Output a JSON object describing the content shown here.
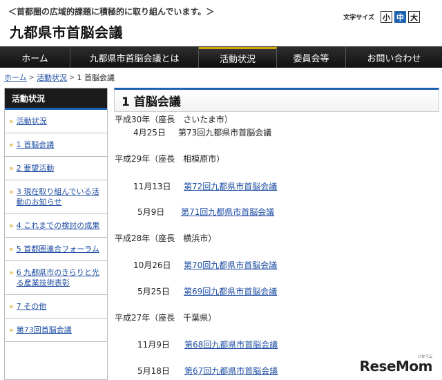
{
  "header": {
    "tagline": "＜首都圏の広域的課題に積極的に取り組んでいます。＞",
    "site_title": "九都県市首脳会議",
    "font_size_label": "文字サイズ",
    "font_size_options": [
      "小",
      "中",
      "大"
    ]
  },
  "nav": {
    "items": [
      "ホーム",
      "九都県市首脳会議とは",
      "活動状況",
      "委員会等",
      "お問い合わせ"
    ]
  },
  "breadcrumb": {
    "home": "ホーム",
    "section": "活動状況",
    "current": "1 首脳会議"
  },
  "sidebar": {
    "heading": "活動状況",
    "items": [
      "活動状況",
      "1 首脳会議",
      "2 要望活動",
      "3 現在取り組んでいる活動のお知らせ",
      "4 これまでの検討の成果",
      "5 首都圏連合フォーラム",
      "6 九都県市のきらりと光る産業技術表彰",
      "7 その他",
      "第73回首脳会議"
    ]
  },
  "main": {
    "heading": "1 首脳会議",
    "years": [
      "平成30年（座長　さいたま市）",
      "平成29年（座長　相模原市）",
      "平成28年（座長　横浜市）",
      "平成27年（座長　千葉県）"
    ],
    "meetings": [
      {
        "date": "4月25日",
        "title": "第73回九都県市首脳会議"
      },
      {
        "date": "11月13日",
        "title": "第72回九都県市首脳会議"
      },
      {
        "date": "5月9日",
        "title": "第71回九都県市首脳会議"
      },
      {
        "date": "10月26日",
        "title": "第70回九都県市首脳会議"
      },
      {
        "date": "5月25日",
        "title": "第69回九都県市首脳会議"
      },
      {
        "date": "11月9日",
        "title": "第68回九都県市首脳会議"
      },
      {
        "date": "5月18日",
        "title": "第67回九都県市首脳会議"
      }
    ]
  },
  "watermark": {
    "text": "ReseMom",
    "sub": "リセマム"
  }
}
